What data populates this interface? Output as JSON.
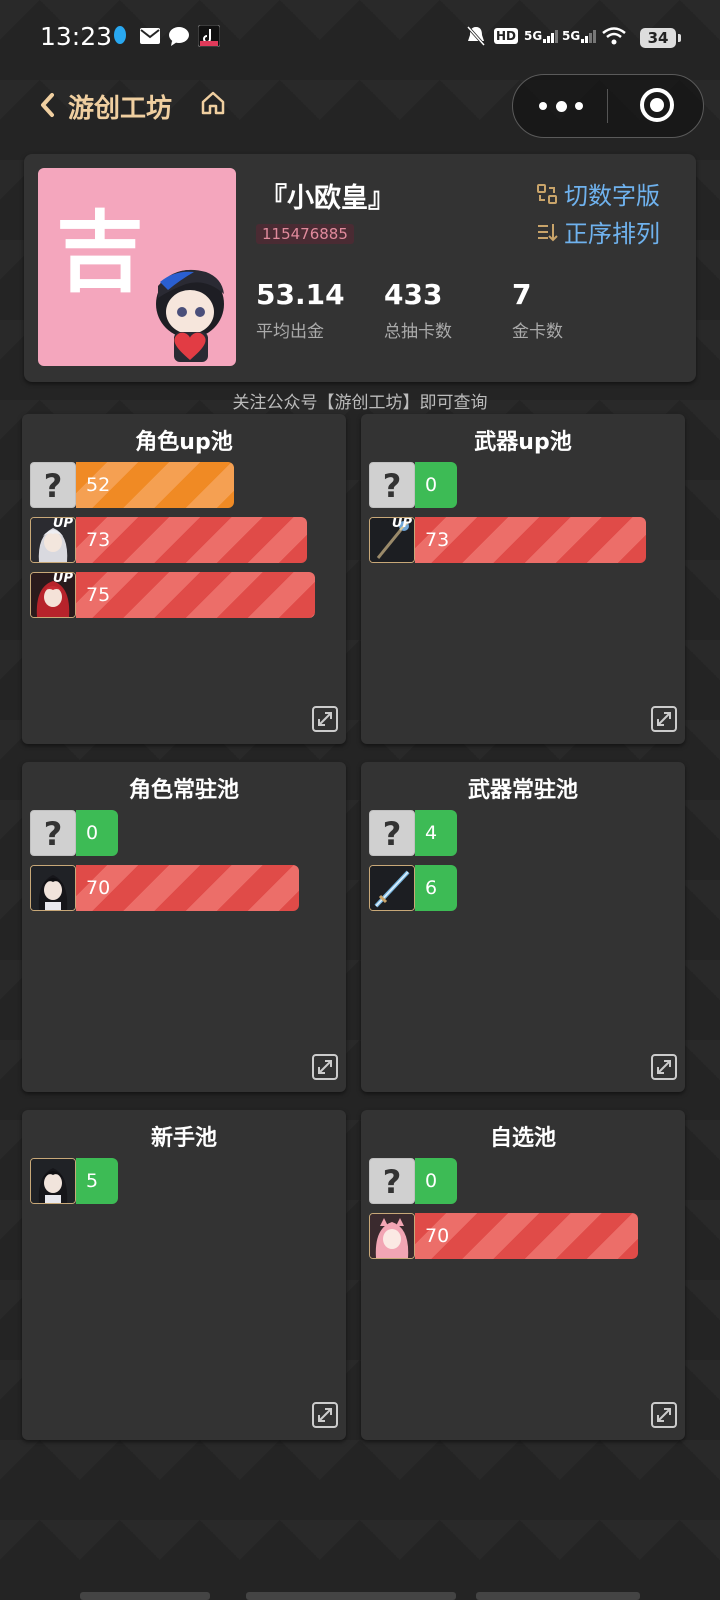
{
  "status_bar": {
    "time": "13:23",
    "battery": "34",
    "sig1": "5G",
    "sig2": "5G",
    "hd": "HD"
  },
  "header": {
    "title": "游创工坊"
  },
  "profile": {
    "avatar_char": "吉",
    "nickname": "『小欧皇』",
    "uid": "115476885",
    "actions": {
      "switch_label": "切数字版",
      "sort_label": "正序排列"
    },
    "stats": [
      {
        "value": "53.14",
        "label": "平均出金"
      },
      {
        "value": "433",
        "label": "总抽卡数"
      },
      {
        "value": "7",
        "label": "金卡数"
      }
    ]
  },
  "follow_tip": "关注公众号【游创工坊】即可查询",
  "pools": [
    {
      "title": "角色up池",
      "rows": [
        {
          "thumb": "unknown",
          "value": "52",
          "color": "orange",
          "fraction": 0.58
        },
        {
          "thumb": "char-silver",
          "up": "UP",
          "value": "73",
          "color": "red",
          "fraction": 0.85
        },
        {
          "thumb": "char-red",
          "up": "UP",
          "value": "75",
          "color": "red",
          "fraction": 0.88
        }
      ]
    },
    {
      "title": "武器up池",
      "rows": [
        {
          "thumb": "unknown",
          "value": "0",
          "color": "green",
          "fraction": 0
        },
        {
          "thumb": "weapon-staff",
          "up": "UP",
          "value": "73",
          "color": "red",
          "fraction": 0.85
        }
      ]
    },
    {
      "title": "角色常驻池",
      "rows": [
        {
          "thumb": "unknown",
          "value": "0",
          "color": "green",
          "fraction": 0
        },
        {
          "thumb": "char-dark",
          "value": "70",
          "color": "red",
          "fraction": 0.82
        }
      ]
    },
    {
      "title": "武器常驻池",
      "rows": [
        {
          "thumb": "unknown",
          "value": "4",
          "color": "green",
          "fraction": 0
        },
        {
          "thumb": "weapon-sword",
          "value": "6",
          "color": "green",
          "fraction": 0
        }
      ]
    },
    {
      "title": "新手池",
      "rows": [
        {
          "thumb": "char-dark",
          "value": "5",
          "color": "green",
          "fraction": 0
        }
      ]
    },
    {
      "title": "自选池",
      "rows": [
        {
          "thumb": "unknown",
          "value": "0",
          "color": "green",
          "fraction": 0
        },
        {
          "thumb": "char-pink",
          "value": "70",
          "color": "red",
          "fraction": 0.82
        }
      ]
    }
  ],
  "colors": {
    "accent_gold": "#f0cfa0",
    "link_blue": "#6fb2ee",
    "green": "#3dbb55",
    "red": "#e04b48",
    "orange": "#f08a24"
  },
  "icons": [
    "back-icon",
    "home-icon",
    "more-icon",
    "target-icon",
    "switch-icon",
    "sort-icon",
    "expand-icon",
    "unknown-icon"
  ]
}
